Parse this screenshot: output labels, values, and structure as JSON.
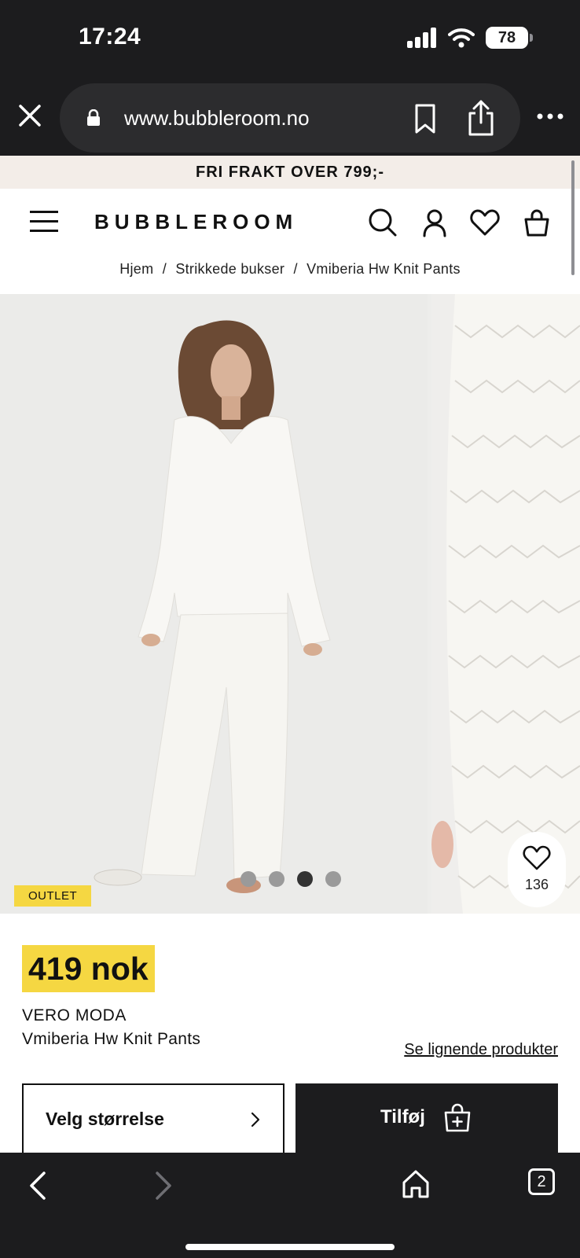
{
  "status_bar": {
    "time": "17:24",
    "battery": "78"
  },
  "browser": {
    "url": "www.bubbleroom.no",
    "tab_count": "2"
  },
  "promo": {
    "text": "FRI FRAKT OVER 799;-"
  },
  "header": {
    "logo": "BUBBLEROOM"
  },
  "breadcrumb": {
    "items": [
      {
        "label": "Hjem"
      },
      {
        "label": "Strikkede bukser"
      },
      {
        "label": "Vmiberia Hw Knit Pants"
      }
    ],
    "separator": "/"
  },
  "gallery": {
    "badge": "OUTLET",
    "wishlist_count": "136",
    "slide_count": 4,
    "active_slide": 3
  },
  "product": {
    "price": "419 nok",
    "brand": "VERO MODA",
    "name": "Vmiberia Hw Knit Pants",
    "similar_link": "Se lignende produkter",
    "size_button": "Velg størrelse",
    "add_button": "Tilføj"
  },
  "colors": {
    "accent_yellow": "#f5d742",
    "banner_bg": "#f3ede8",
    "dark": "#1c1c1e"
  }
}
